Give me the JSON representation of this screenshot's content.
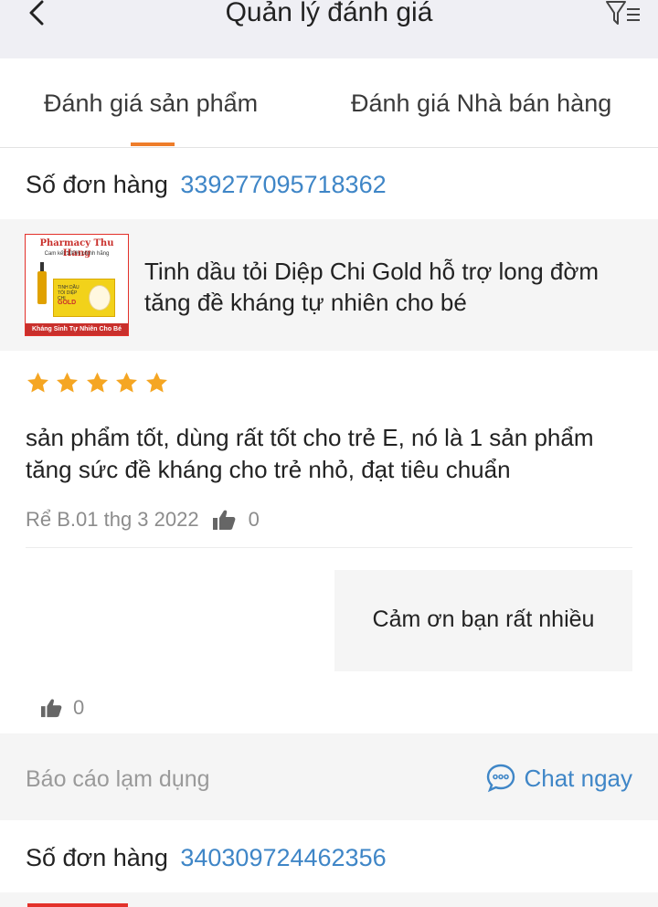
{
  "header": {
    "title": "Quản lý đánh giá",
    "back_icon": "chevron-left-icon",
    "filter_icon": "filter-list-icon"
  },
  "tabs": [
    {
      "label": "Đánh giá sản phẩm",
      "active": true
    },
    {
      "label": "Đánh giá Nhà bán hàng",
      "active": false
    }
  ],
  "colors": {
    "accent": "#ee7d2a",
    "link": "#3f86c7",
    "star": "#f5a623",
    "header_bg": "#efeff4",
    "section_bg": "#f5f5f5"
  },
  "orders": [
    {
      "label": "Số đơn hàng",
      "number": "339277095718362",
      "product": {
        "name": "Tinh dầu tỏi Diệp Chi Gold hỗ trợ long đờm tăng đề kháng tự nhiên cho bé",
        "thumb_brand": "Pharmacy Thu Hang",
        "thumb_sub": "Cam kết 100% chính hãng",
        "thumb_box_text": "TINH DẦU TỎI DIỆP CHI",
        "thumb_box_gold": "GOLD",
        "thumb_footer": "Kháng Sinh Tự Nhiên Cho Bé"
      },
      "rating": 5,
      "review": "sản phẩm tốt, dùng rất tốt cho trẻ E, nó là 1 sản phẩm tăng sức đề kháng cho trẻ nhỏ, đạt tiêu chuẩn",
      "reviewer_date": "Rể B.01 thg 3 2022",
      "likes": "0",
      "seller_reply": "Cảm ơn bạn rất nhiều",
      "reply_likes": "0",
      "report_label": "Báo cáo lạm dụng",
      "chat_label": "Chat ngay"
    },
    {
      "label": "Số đơn hàng",
      "number": "340309724462356"
    }
  ]
}
